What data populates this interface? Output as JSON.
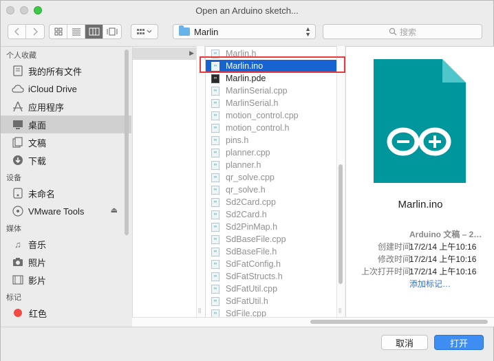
{
  "window": {
    "title": "Open an Arduino sketch..."
  },
  "toolbar": {
    "path_label": "Marlin",
    "search_placeholder": "搜索"
  },
  "sidebar": {
    "favorites_header": "个人收藏",
    "favorites": [
      {
        "label": "我的所有文件",
        "icon": "all-files-icon"
      },
      {
        "label": "iCloud Drive",
        "icon": "cloud-icon"
      },
      {
        "label": "应用程序",
        "icon": "applications-icon"
      },
      {
        "label": "桌面",
        "icon": "desktop-icon"
      },
      {
        "label": "文稿",
        "icon": "documents-icon"
      },
      {
        "label": "下载",
        "icon": "downloads-icon"
      }
    ],
    "devices_header": "设备",
    "devices": [
      {
        "label": "未命名",
        "icon": "disk-icon"
      },
      {
        "label": "VMware Tools",
        "icon": "disc-icon"
      }
    ],
    "media_header": "媒体",
    "media": [
      {
        "label": "音乐",
        "icon": "music-icon"
      },
      {
        "label": "照片",
        "icon": "camera-icon"
      },
      {
        "label": "影片",
        "icon": "film-icon"
      }
    ],
    "tags_header": "标记",
    "tags": [
      {
        "label": "红色",
        "color": "#f14c43"
      }
    ]
  },
  "files": [
    "Marlin.h",
    "Marlin.ino",
    "Marlin.pde",
    "MarlinSerial.cpp",
    "MarlinSerial.h",
    "motion_control.cpp",
    "motion_control.h",
    "pins.h",
    "planner.cpp",
    "planner.h",
    "qr_solve.cpp",
    "qr_solve.h",
    "Sd2Card.cpp",
    "Sd2Card.h",
    "Sd2PinMap.h",
    "SdBaseFile.cpp",
    "SdBaseFile.h",
    "SdFatConfig.h",
    "SdFatStructs.h",
    "SdFatUtil.cpp",
    "SdFatUtil.h",
    "SdFile.cpp"
  ],
  "selected_file": "Marlin.ino",
  "preview": {
    "name": "Marlin.ino",
    "kind": "Arduino 文稿 – 2…",
    "created_label": "创建时间",
    "created_value": "17/2/14 上午10:16",
    "modified_label": "修改时间",
    "modified_value": "17/2/14 上午10:16",
    "opened_label": "上次打开时间",
    "opened_value": "17/2/14 上午10:16",
    "add_tags": "添加标记…",
    "icon_color": "#00979c"
  },
  "footer": {
    "cancel_label": "取消",
    "open_label": "打开"
  },
  "colors": {
    "selection": "#1663d1",
    "primary_button": "#3d8df2",
    "highlight_box": "#e8393b"
  }
}
